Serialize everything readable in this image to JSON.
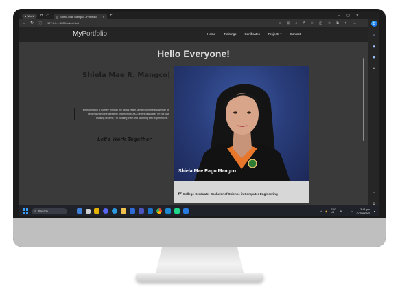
{
  "browser": {
    "profile_label": "Work",
    "tab_title": "Shiela Mae Mangco - Portfolio",
    "tab_close": "×",
    "new_tab": "+",
    "url": "127.0.0.1:5500/index.html"
  },
  "site": {
    "brand_part1": "My",
    "brand_part2": "Portfolio",
    "nav": [
      "Home",
      "Trainings",
      "Certificates",
      "Projects",
      "Contact"
    ],
    "projects_caret": "▾",
    "heading": "Hello Everyone!",
    "name": "Shiela Mae R. Mangco|",
    "quote": "\"Embarking on a journey through the digital realm, armed with the knowledge of yesterday and the creativity of tomorrow. As a recent graduate, I'm not just chasing dreams; I'm building them into stunning web experiences.\"",
    "cta": "Let's Work Together",
    "photo_caption": "Shiela Mae Rago Mangco",
    "card_line": "College Graduate: Bachelor of Science in Computer Engineering"
  },
  "taskbar": {
    "search_label": "Search",
    "lang_top": "ENG",
    "lang_bottom": "US",
    "time": "3:41 pm",
    "date": "27/02/2025"
  },
  "colors": {
    "site_bg": "#3a3a3a",
    "nav_bg": "#242424",
    "photo_bg": "#2a3e7c",
    "card_bg": "#d7d7d7",
    "accent_orange": "#e8762b"
  },
  "icons": [
    "back-icon",
    "refresh-icon",
    "info-icon",
    "copilot-icon",
    "windows-start-icon",
    "search-icon",
    "graduation-icon",
    "wifi-icon",
    "volume-icon",
    "battery-icon"
  ]
}
